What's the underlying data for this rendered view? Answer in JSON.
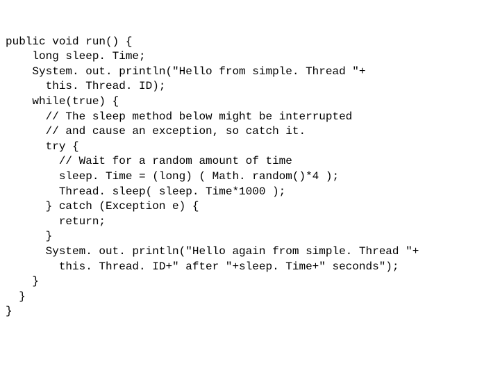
{
  "code": {
    "l01": "public void run() {",
    "l02": "    long sleep. Time;",
    "l03": "    System. out. println(\"Hello from simple. Thread \"+",
    "l04": "      this. Thread. ID);",
    "l05": "    while(true) {",
    "l06": "      // The sleep method below might be interrupted",
    "l07": "      // and cause an exception, so catch it.",
    "l08": "      try {",
    "l09": "        // Wait for a random amount of time",
    "l10": "        sleep. Time = (long) ( Math. random()*4 );",
    "l11": "        Thread. sleep( sleep. Time*1000 );",
    "l12": "      } catch (Exception e) {",
    "l13": "        return;",
    "l14": "      }",
    "l15": "      System. out. println(\"Hello again from simple. Thread \"+",
    "l16": "        this. Thread. ID+\" after \"+sleep. Time+\" seconds\");",
    "l17": "    }",
    "l18": "  }",
    "l19": "}"
  }
}
